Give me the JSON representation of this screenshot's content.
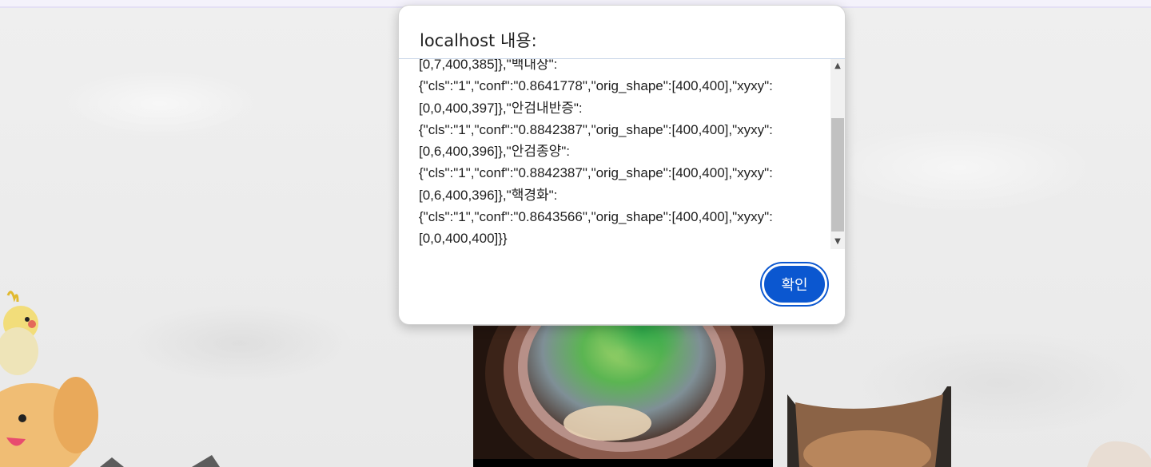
{
  "dialog": {
    "title": "localhost 내용:",
    "message": "[0,7,400,385]},\"백내장\":\n{\"cls\":\"1\",\"conf\":\"0.8641778\",\"orig_shape\":[400,400],\"xyxy\":\n[0,0,400,397]},\"안검내반증\":\n{\"cls\":\"1\",\"conf\":\"0.8842387\",\"orig_shape\":[400,400],\"xyxy\":\n[0,6,400,396]},\"안검종양\":\n{\"cls\":\"1\",\"conf\":\"0.8842387\",\"orig_shape\":[400,400],\"xyxy\":\n[0,6,400,396]},\"핵경화\":\n{\"cls\":\"1\",\"conf\":\"0.8643566\",\"orig_shape\":[400,400],\"xyxy\":\n[0,0,400,400]}}",
    "ok_label": "확인",
    "scroll_up_icon": "▲",
    "scroll_down_icon": "▼"
  },
  "colors": {
    "button": "#0b57d0",
    "page_background": "#ececec"
  },
  "icons": {
    "scroll_up": "chevron-up-icon",
    "scroll_down": "chevron-down-icon"
  }
}
